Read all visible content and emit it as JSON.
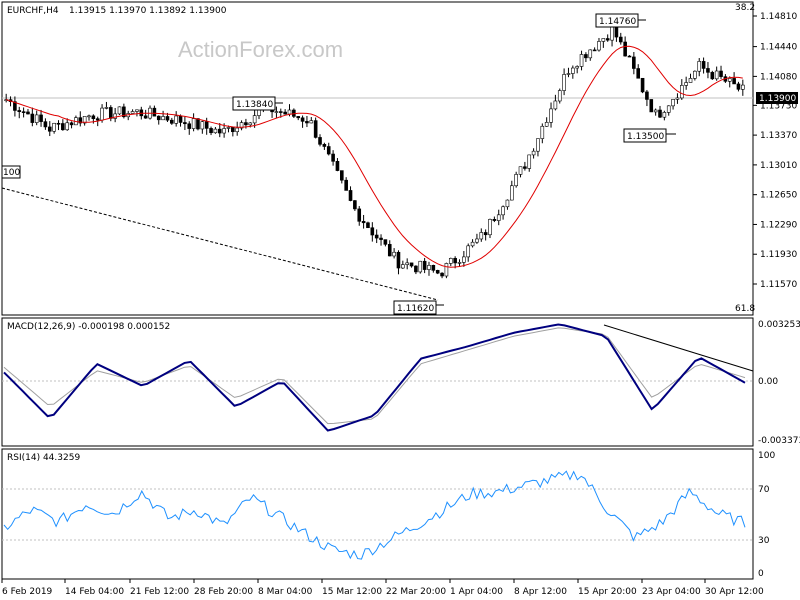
{
  "chart_data": [
    {
      "type": "candlestick",
      "panel": "price",
      "header": {
        "symbol": "EURCHF,H4",
        "ohlc": "1.13915 1.13970 1.13892 1.13900"
      },
      "watermark": "ActionForex.com",
      "ylim": [
        1.1157,
        1.1506
      ],
      "y_ticks": [
        "1.14810",
        "1.14440",
        "1.14080",
        "1.13730",
        "1.13370",
        "1.13010",
        "1.12650",
        "1.12290",
        "1.11930",
        "1.11570"
      ],
      "last_price_label": "1.13900",
      "fib_labels": {
        "top": "38.2",
        "bottom": "61.8"
      },
      "annotations": [
        "1.14760",
        "1.13840",
        "1.13500",
        "1.11620",
        "100"
      ],
      "x_tick_labels": [
        "6 Feb 2019",
        "14 Feb 04:00",
        "21 Feb 12:00",
        "28 Feb 20:00",
        "8 Mar 04:00",
        "15 Mar 12:00",
        "22 Mar 20:00",
        "1 Apr 04:00",
        "8 Apr 12:00",
        "15 Apr 20:00",
        "23 Apr 04:00",
        "30 Apr 12:00"
      ],
      "moving_average_color": "#e00000",
      "candle_color": "#000000",
      "trendline": "dashed",
      "series_close_approx": [
        {
          "date": "6 Feb 2019",
          "close": 1.138
        },
        {
          "date": "11 Feb",
          "close": 1.1345
        },
        {
          "date": "14 Feb 04:00",
          "close": 1.1362
        },
        {
          "date": "21 Feb 12:00",
          "close": 1.1365
        },
        {
          "date": "28 Feb 20:00",
          "close": 1.1355
        },
        {
          "date": "6 Mar",
          "close": 1.134
        },
        {
          "date": "8 Mar 04:00",
          "close": 1.137
        },
        {
          "date": "15 Mar 12:00",
          "close": 1.1355
        },
        {
          "date": "19 Mar",
          "close": 1.125
        },
        {
          "date": "22 Mar 20:00",
          "close": 1.1185
        },
        {
          "date": "26 Mar",
          "close": 1.117
        },
        {
          "date": "1 Apr 04:00",
          "close": 1.1215
        },
        {
          "date": "8 Apr 12:00",
          "close": 1.1305
        },
        {
          "date": "15 Apr 20:00",
          "close": 1.142
        },
        {
          "date": "18 Apr",
          "close": 1.1465
        },
        {
          "date": "23 Apr 04:00",
          "close": 1.136
        },
        {
          "date": "26 Apr",
          "close": 1.142
        },
        {
          "date": "30 Apr 12:00",
          "close": 1.139
        }
      ]
    },
    {
      "type": "line",
      "panel": "macd",
      "title": "MACD(12,26,9) -0.000198 0.000152",
      "ylim": [
        -0.003373,
        0.003253
      ],
      "y_ticks": [
        "0.003253",
        "0.00",
        "-0.003373"
      ],
      "series": [
        {
          "name": "MACD",
          "color": "#00007f",
          "values": [
            0.0005,
            -0.0022,
            0.001,
            -0.0003,
            0.0012,
            -0.0015,
            0.0,
            -0.0029,
            -0.002,
            0.0013,
            0.002,
            0.0028,
            0.0033,
            0.0026,
            -0.0017,
            0.0014,
            -0.0001
          ]
        },
        {
          "name": "Signal",
          "color": "#a0a0a0",
          "values": [
            0.0008,
            -0.0015,
            0.0006,
            -0.0001,
            0.0009,
            -0.001,
            0.0002,
            -0.0025,
            -0.0022,
            0.001,
            0.0018,
            0.0026,
            0.0031,
            0.0027,
            -0.001,
            0.001,
            0.0002
          ]
        }
      ],
      "trendline": "solid"
    },
    {
      "type": "line",
      "panel": "rsi",
      "title": "RSI(14) 44.3259",
      "ylim": [
        0,
        100
      ],
      "y_ticks": [
        "100",
        "70",
        "30",
        "0"
      ],
      "levels": [
        70,
        30
      ],
      "series": [
        {
          "name": "RSI",
          "color": "#1e90ff",
          "values": [
            40,
            55,
            45,
            60,
            52,
            70,
            48,
            55,
            42,
            65,
            50,
            35,
            22,
            18,
            30,
            42,
            55,
            68,
            70,
            75,
            80,
            85,
            55,
            32,
            45,
            70,
            52,
            44
          ]
        }
      ]
    }
  ]
}
